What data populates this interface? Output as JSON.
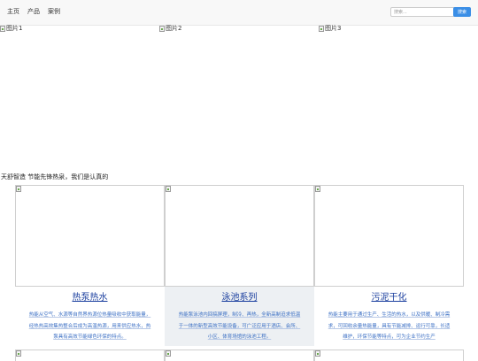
{
  "nav": {
    "links": [
      "主页",
      "产品",
      "案例"
    ],
    "search_placeholder": "搜索...",
    "search_button": "搜索"
  },
  "banners": [
    {
      "alt": "图片1"
    },
    {
      "alt": "图片2"
    },
    {
      "alt": "图片3"
    }
  ],
  "tagline": "天舒智造 节能先锋热泉，我们是认真的",
  "cards": [
    {
      "title": "热泵热水",
      "description": "热能从空气、水源等自然界热源位热量吸收中获取能量，经热热高效集热整合后成为高温热源，用来供应热水，热泵具有高效节能绿色环保的特点。"
    },
    {
      "title": "泳池系列",
      "description": "热能泵泳池内回搞屏理，制冷、再热，全新高制迫求低温于一体的新型高效节能设备，可广泛应用于酒店、会所、小区、体育场馆的泳池工程。"
    },
    {
      "title": "污泥干化",
      "description": "热能主要用于通过生产、生活的热水，以及供暖、制冷需求，可回收余量热能量，具有节能减排、运行可靠，长适维护，环保节能等特点，可为企业节约生产"
    }
  ]
}
